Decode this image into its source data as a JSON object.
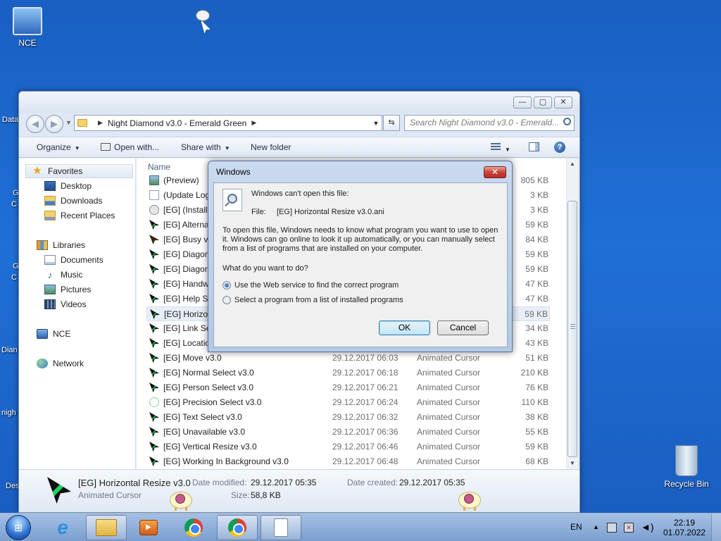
{
  "desktop": {
    "icons": [
      {
        "label": "NCE"
      },
      {
        "label": "Recycle Bin"
      }
    ],
    "edge_labels": [
      "Data",
      "G",
      "C",
      "G",
      "C",
      "Dian",
      "nigh",
      "Des"
    ]
  },
  "explorer": {
    "caption": {
      "minimize": "—",
      "maximize": "▢",
      "close": "✕"
    },
    "address": {
      "path": "Night Diamond v3.0 - Emerald Green",
      "arrow": "▶"
    },
    "search_placeholder": "Search Night Diamond v3.0 - Emerald...",
    "toolbar": {
      "organize": "Organize",
      "open_with": "Open with...",
      "share_with": "Share with",
      "new_folder": "New folder"
    },
    "nav": {
      "favorites": "Favorites",
      "desktop": "Desktop",
      "downloads": "Downloads",
      "recent_places": "Recent Places",
      "libraries": "Libraries",
      "documents": "Documents",
      "music": "Music",
      "pictures": "Pictures",
      "videos": "Videos",
      "nce": "NCE",
      "network": "Network"
    },
    "columns": {
      "name": "Name"
    },
    "files": [
      {
        "name": "(Preview)",
        "date": "",
        "type": "",
        "size": "805 KB",
        "icon": "image-icon"
      },
      {
        "name": "(Update Log",
        "date": "",
        "type": "",
        "size": "3 KB",
        "icon": "text-document-icon"
      },
      {
        "name": "[EG] (Installe",
        "date": "",
        "type": "",
        "size": "3 KB",
        "icon": "setup-information-icon"
      },
      {
        "name": "[EG] Alterna",
        "date": "",
        "type": "",
        "size": "59 KB",
        "icon": "cursor-icon"
      },
      {
        "name": "[EG] Busy v3",
        "date": "",
        "type": "",
        "size": "84 KB",
        "icon": "busy-cursor-icon"
      },
      {
        "name": "[EG] Diagon",
        "date": "",
        "type": "",
        "size": "59 KB",
        "icon": "cursor-icon"
      },
      {
        "name": "[EG] Diagon",
        "date": "",
        "type": "",
        "size": "59 KB",
        "icon": "cursor-icon"
      },
      {
        "name": "[EG] Handw",
        "date": "",
        "type": "",
        "size": "47 KB",
        "icon": "cursor-icon"
      },
      {
        "name": "[EG] Help Se",
        "date": "",
        "type": "",
        "size": "47 KB",
        "icon": "cursor-icon"
      },
      {
        "name": "[EG] Horizon",
        "date": "",
        "type": "",
        "size": "59 KB",
        "icon": "cursor-icon",
        "selected": true
      },
      {
        "name": "[EG] Link Se",
        "date": "",
        "type": "",
        "size": "34 KB",
        "icon": "cursor-icon"
      },
      {
        "name": "[EG] Locatio",
        "date": "",
        "type": "",
        "size": "43 KB",
        "icon": "cursor-icon"
      },
      {
        "name": "[EG] Move v3.0",
        "date": "29.12.2017 06:03",
        "type": "Animated Cursor",
        "size": "51 KB",
        "icon": "cursor-icon"
      },
      {
        "name": "[EG] Normal Select v3.0",
        "date": "29.12.2017 06:18",
        "type": "Animated Cursor",
        "size": "210 KB",
        "icon": "cursor-icon"
      },
      {
        "name": "[EG] Person Select v3.0",
        "date": "29.12.2017 06:21",
        "type": "Animated Cursor",
        "size": "76 KB",
        "icon": "cursor-icon"
      },
      {
        "name": "[EG] Precision Select v3.0",
        "date": "29.12.2017 06:24",
        "type": "Animated Cursor",
        "size": "110 KB",
        "icon": "precision-cursor-icon"
      },
      {
        "name": "[EG] Text Select v3.0",
        "date": "29.12.2017 06:32",
        "type": "Animated Cursor",
        "size": "38 KB",
        "icon": "cursor-icon"
      },
      {
        "name": "[EG] Unavailable v3.0",
        "date": "29.12.2017 06:36",
        "type": "Animated Cursor",
        "size": "55 KB",
        "icon": "cursor-icon"
      },
      {
        "name": "[EG] Vertical Resize v3.0",
        "date": "29.12.2017 06:46",
        "type": "Animated Cursor",
        "size": "59 KB",
        "icon": "cursor-icon"
      },
      {
        "name": "[EG] Working In Background v3.0",
        "date": "29.12.2017 06:48",
        "type": "Animated Cursor",
        "size": "68 KB",
        "icon": "cursor-icon"
      }
    ],
    "details": {
      "filename": "[EG] Horizontal Resize v3.0",
      "filetype": "Animated Cursor",
      "date_modified_label": "Date modified:",
      "date_modified": "29.12.2017 05:35",
      "date_created_label": "Date created:",
      "date_created": "29.12.2017 05:35",
      "size_label": "Size:",
      "size": "58,8 KB"
    }
  },
  "dialog": {
    "title": "Windows",
    "close": "✕",
    "heading": "Windows can't open this file:",
    "file_label": "File:",
    "file_name": "[EG] Horizontal Resize v3.0.ani",
    "paragraph": "To open this file, Windows needs to know what program you want to use to open it. Windows can go online to look it up automatically, or you can manually select from a list of programs that are installed on your computer.",
    "question": "What do you want to do?",
    "option_web": "Use the Web service to find the correct program",
    "option_list": "Select a program from a list of installed programs",
    "ok": "OK",
    "cancel": "Cancel"
  },
  "taskbar": {
    "start": "⊞",
    "ie": "e",
    "media": "▶",
    "lang": "EN",
    "tray_arrow": "▲",
    "time": "22:19",
    "date": "01.07.2022"
  }
}
